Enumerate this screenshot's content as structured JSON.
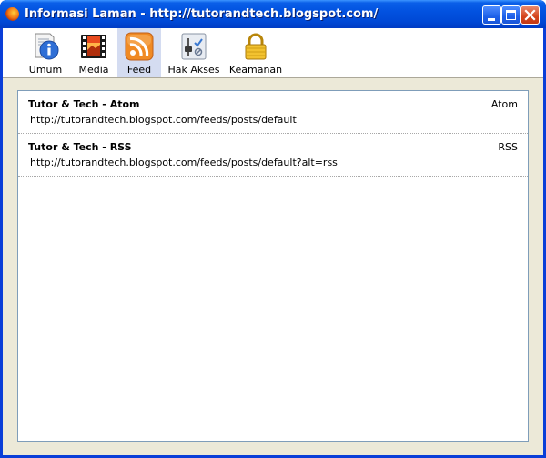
{
  "window": {
    "title": "Informasi Laman - http://tutorandtech.blogspot.com/",
    "app_icon": "firefox-icon",
    "controls": [
      "minimize-icon",
      "maximize-icon",
      "close-icon"
    ]
  },
  "toolbar": {
    "items": [
      {
        "label": "Umum",
        "icon": "info-icon",
        "active": false
      },
      {
        "label": "Media",
        "icon": "film-icon",
        "active": false
      },
      {
        "label": "Feed",
        "icon": "rss-icon",
        "active": true
      },
      {
        "label": "Hak Akses",
        "icon": "permissions-icon",
        "active": false
      },
      {
        "label": "Keamanan",
        "icon": "lock-icon",
        "active": false
      }
    ]
  },
  "feeds": [
    {
      "title": "Tutor & Tech - Atom",
      "type": "Atom",
      "url": "http://tutorandtech.blogspot.com/feeds/posts/default"
    },
    {
      "title": "Tutor & Tech - RSS",
      "type": "RSS",
      "url": "http://tutorandtech.blogspot.com/feeds/posts/default?alt=rss"
    }
  ],
  "colors": {
    "titlebar": "#0049d6",
    "active_tab": "#d4dcf1",
    "dialog_bg": "#ece9d8",
    "list_border": "#7f9db9"
  }
}
